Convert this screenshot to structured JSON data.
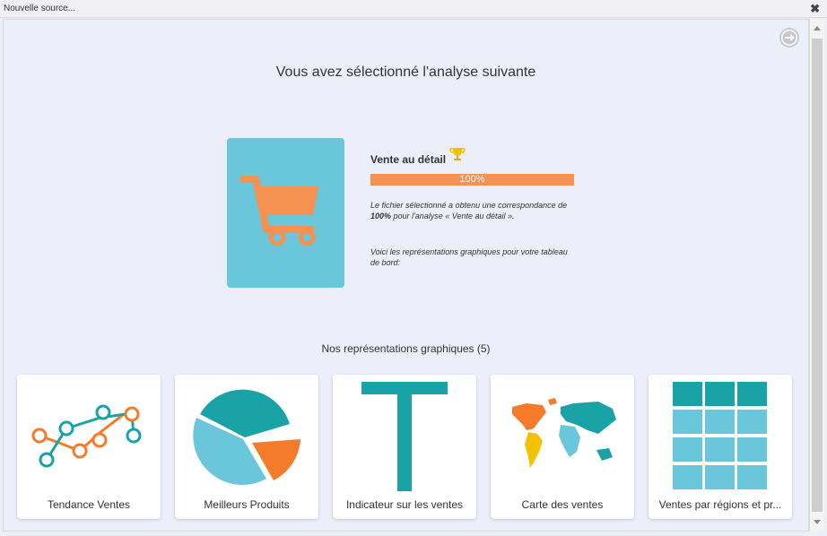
{
  "window": {
    "title": "Nouvelle source..."
  },
  "header": {
    "heading": "Vous avez sélectionné l'analyse suivante"
  },
  "analysis": {
    "name": "Vente au détail",
    "match_percent": 100,
    "match_label": "100%",
    "desc_part1": "Le fichier sélectionné a obtenu une correspondance de ",
    "desc_bold": "100%",
    "desc_part2": " pour l'analyse « Vente au détail ».",
    "desc_charts": "Voici les représentations graphiques pour votre tableau de bord:"
  },
  "charts_section": {
    "heading": "Nos représentations graphiques (5)",
    "cards": [
      {
        "label": "Tendance Ventes",
        "icon": "line-chart-icon"
      },
      {
        "label": "Meilleurs Produits",
        "icon": "pie-chart-icon"
      },
      {
        "label": "Indicateur sur les ventes",
        "icon": "indicator-icon"
      },
      {
        "label": "Carte des ventes",
        "icon": "world-map-icon"
      },
      {
        "label": "Ventes par régions et pr...",
        "icon": "table-icon"
      }
    ]
  },
  "colors": {
    "teal": "#1aa3a6",
    "light_blue": "#69c6db",
    "orange": "#f47b2a",
    "progress": "#f59151"
  }
}
